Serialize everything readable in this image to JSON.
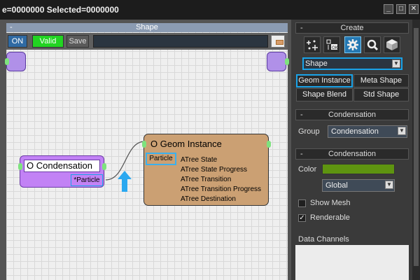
{
  "window": {
    "title": "e=0000000  Selected=0000000",
    "min_label": "_",
    "max_label": "□",
    "close_label": "✕"
  },
  "graph": {
    "panel_title": "Shape",
    "collapse": "-",
    "toolbar": {
      "on": "ON",
      "valid": "Valid",
      "save": "Save"
    },
    "condensation_node": {
      "title": "O Condensation",
      "port": "*Particle"
    },
    "geom_node": {
      "title": "O Geom Instance",
      "port": "Particle",
      "attributes": [
        "ATree State",
        "ATree State Progress",
        "ATree Transition",
        "ATree Transition Progress",
        "ATree Destination"
      ]
    }
  },
  "props": {
    "create": {
      "title": "Create",
      "collapse": "-",
      "icons": [
        "particle-add-icon",
        "operator-icon",
        "gear-icon",
        "wrench-icon",
        "cube-icon"
      ],
      "category": "Shape",
      "buttons": [
        {
          "label": "Geom Instance",
          "selected": true
        },
        {
          "label": "Meta Shape",
          "selected": false
        },
        {
          "label": "Shape Blend",
          "selected": false
        },
        {
          "label": "Std Shape",
          "selected": false
        }
      ]
    },
    "condensation_group": {
      "title": "Condensation",
      "collapse": "-",
      "group_label": "Group",
      "group_value": "Condensation"
    },
    "condensation": {
      "title": "Condensation",
      "collapse": "-",
      "color_label": "Color",
      "color": "#5e9410",
      "color_mode": "Global",
      "show_mesh_label": "Show Mesh",
      "show_mesh": false,
      "renderable_label": "Renderable",
      "renderable": true,
      "data_channels_label": "Data Channels"
    }
  }
}
